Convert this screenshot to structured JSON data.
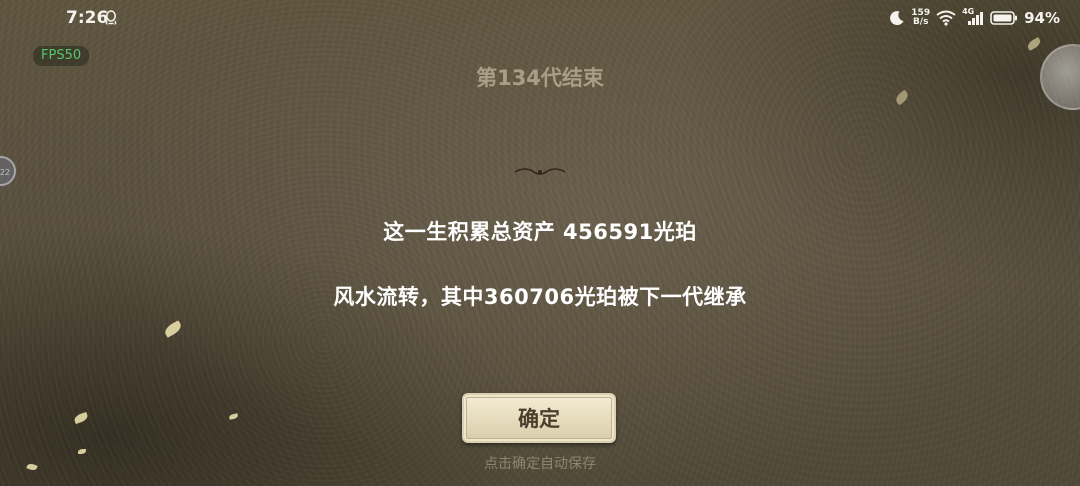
{
  "status_bar": {
    "time": "7:26",
    "net_speed_value": "159",
    "net_speed_unit": "B/s",
    "network_type": "4G",
    "battery_percent": "94%"
  },
  "overlay": {
    "fps": "FPS50",
    "left_float_label": "22"
  },
  "dialog": {
    "title": "第134代结束",
    "total_assets_line": "这一生积累总资产 456591光珀",
    "inherit_line": "风水流转，其中360706光珀被下一代继承",
    "confirm_label": "确定",
    "save_hint": "点击确定自动保存"
  },
  "colors": {
    "background": "#5a5140",
    "title": "#a99f86",
    "button_bg": "#ebe1c4",
    "button_text": "#4a3f2c",
    "fps_green": "#55c86a"
  },
  "icons": [
    "qq-notification-icon",
    "moon-icon",
    "wifi-icon",
    "signal-icon",
    "battery-icon"
  ]
}
